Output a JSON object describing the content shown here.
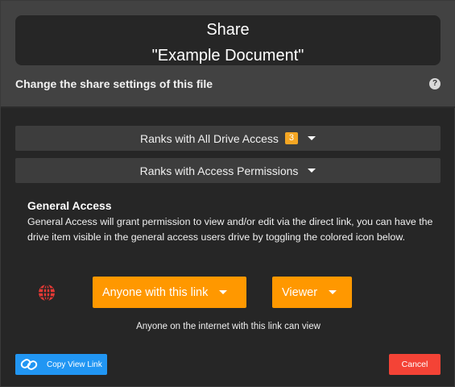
{
  "dialog": {
    "title_line1": "Share",
    "title_line2": "\"Example Document\"",
    "subtitle": "Change the share settings of this file",
    "help_icon": "?"
  },
  "sections": {
    "drive_access_label": "Ranks with All Drive Access",
    "drive_access_count": "3",
    "permissions_label": "Ranks with Access Permissions"
  },
  "general_access": {
    "title": "General Access",
    "description": "General Access will grant permission to view and/or edit via the direct link, you can have the drive item visible in the general access users drive by toggling the colored icon below.",
    "scope_selected": "Anyone with this link",
    "role_selected": "Viewer",
    "note": "Anyone on the internet with this link can view"
  },
  "actions": {
    "copy_link": "Copy View Link",
    "cancel": "Cancel"
  },
  "colors": {
    "accent_orange": "#ff9800",
    "badge_orange": "#f5a623",
    "primary_blue": "#2196f3",
    "danger_red": "#f44336",
    "globe_red": "#e53935"
  },
  "icons": {
    "globe": "globe-icon",
    "link": "link-icon",
    "help": "help-icon"
  }
}
